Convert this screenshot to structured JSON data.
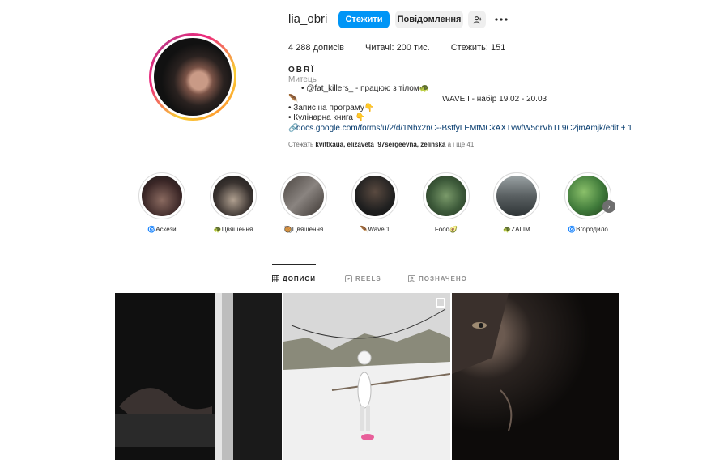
{
  "profile": {
    "username": "lia_obri",
    "follow_label": "Стежити",
    "message_label": "Повідомлення",
    "stats": {
      "posts": "4 288 дописів",
      "followers": "Читачі: 200 тис.",
      "following": "Стежить: 151"
    },
    "full_name": "OBRÏ",
    "category": "Митець",
    "bio": {
      "line1": "• @fat_killers_ - працюю з тілом🐢",
      "line2_left": "🪶",
      "line2_right": "WAVE I - набір 19.02 - 20.03",
      "line3": "• Запис на програму👇",
      "line4": "• Кулінарна книга 👇",
      "link": "docs.google.com/forms/u/2/d/1Nhx2nC--BstfyLEMtMCkAXTvwfW5qrVbTL9C2jmAmjk/edit + 1"
    },
    "followed_by": {
      "prefix": "Стежать ",
      "names": "kvittkaua, elizaveta_97sergeevna, zelinska",
      "suffix": " а і ще 41"
    }
  },
  "highlights": [
    {
      "label": "🌀Аскези",
      "color": "#5a3a3a"
    },
    {
      "label": "🐢Цвяшення",
      "color": "#3a3330"
    },
    {
      "label": "🥘Цвяшення",
      "color": "#6a6460"
    },
    {
      "label": "🪶Wave 1",
      "color": "#2a2a2a"
    },
    {
      "label": "Food🥑",
      "color": "#3d5a3a"
    },
    {
      "label": "🐢ZALIM",
      "color": "#5a6062"
    },
    {
      "label": "🌀Вгородило",
      "color": "#3f7a3a"
    }
  ],
  "tabs": [
    {
      "label": "ДОПИСИ",
      "icon": "grid-icon",
      "active": true
    },
    {
      "label": "REELS",
      "icon": "reels-icon",
      "active": false
    },
    {
      "label": "ПОЗНАЧЕНО",
      "icon": "tagged-icon",
      "active": false
    }
  ],
  "colors": {
    "primary": "#0095f6",
    "secondary_button": "#efefef",
    "text": "#262626",
    "muted": "#8e8e8e",
    "link": "#00376b"
  }
}
